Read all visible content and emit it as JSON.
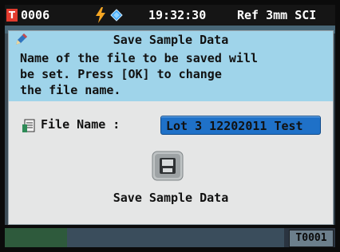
{
  "status_bar": {
    "badge": "T",
    "sample_id": "0006",
    "time": "19:32:30",
    "measure_info": "Ref 3mm SCI",
    "icons": [
      "bolt-icon",
      "diamond-icon"
    ]
  },
  "dialog": {
    "title": "Save Sample Data",
    "message": "Name of the file to be saved will\nbe set. Press [OK] to change\nthe file name.",
    "file_name_label": "File Name :",
    "file_name_value": "Lot 3 12202011 Test",
    "save_caption": "Save Sample Data"
  },
  "bottom_bar": {
    "code": "T0001"
  },
  "colors": {
    "header_bg": "#9fd4ea",
    "dialog_bg": "#e5e6e6",
    "input_bg": "#1f71c8",
    "badge_red": "#e23b2e"
  }
}
